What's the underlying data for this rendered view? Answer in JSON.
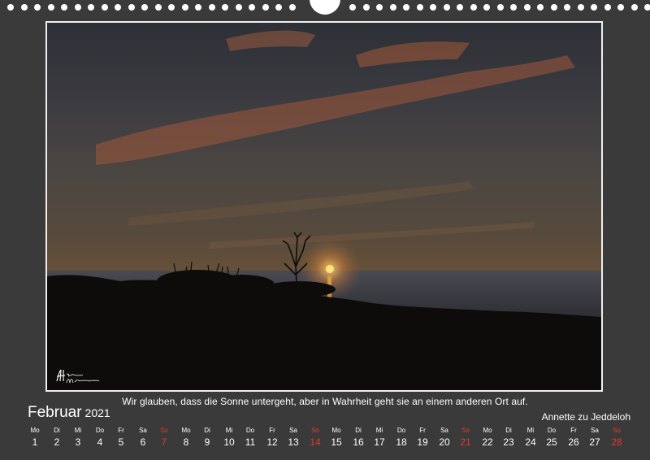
{
  "caption": "Wir glauben, dass die Sonne untergeht, aber in Wahrheit geht sie an einem anderen Ort auf.",
  "month": "Februar",
  "year": "2021",
  "author": "Annette zu Jeddeloh",
  "signature": "Heinrich Wilkshausen",
  "days": [
    {
      "dn": "Mo",
      "d": "1"
    },
    {
      "dn": "Di",
      "d": "2"
    },
    {
      "dn": "Mi",
      "d": "3"
    },
    {
      "dn": "Do",
      "d": "4"
    },
    {
      "dn": "Fr",
      "d": "5"
    },
    {
      "dn": "Sa",
      "d": "6"
    },
    {
      "dn": "So",
      "d": "7",
      "sun": true
    },
    {
      "dn": "Mo",
      "d": "8"
    },
    {
      "dn": "Di",
      "d": "9"
    },
    {
      "dn": "Mi",
      "d": "10"
    },
    {
      "dn": "Do",
      "d": "11"
    },
    {
      "dn": "Fr",
      "d": "12"
    },
    {
      "dn": "Sa",
      "d": "13"
    },
    {
      "dn": "So",
      "d": "14",
      "sun": true
    },
    {
      "dn": "Mo",
      "d": "15"
    },
    {
      "dn": "Di",
      "d": "16"
    },
    {
      "dn": "Mi",
      "d": "17"
    },
    {
      "dn": "Do",
      "d": "18"
    },
    {
      "dn": "Fr",
      "d": "19"
    },
    {
      "dn": "Sa",
      "d": "20"
    },
    {
      "dn": "So",
      "d": "21",
      "sun": true
    },
    {
      "dn": "Mo",
      "d": "22"
    },
    {
      "dn": "Di",
      "d": "23"
    },
    {
      "dn": "Mi",
      "d": "24"
    },
    {
      "dn": "Do",
      "d": "25"
    },
    {
      "dn": "Fr",
      "d": "26"
    },
    {
      "dn": "Sa",
      "d": "27"
    },
    {
      "dn": "So",
      "d": "28",
      "sun": true
    }
  ],
  "colors": {
    "background": "#3a3a3a",
    "text": "#ffffff",
    "sunday": "#e23a2e"
  }
}
